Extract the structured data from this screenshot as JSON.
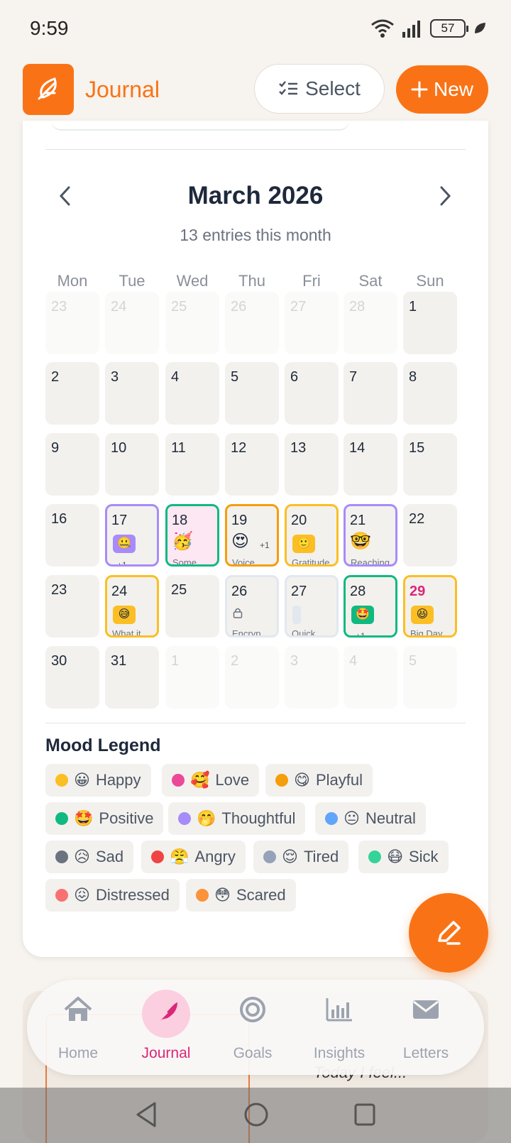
{
  "status_bar": {
    "time": "9:59",
    "battery": "57"
  },
  "header": {
    "title": "Journal",
    "select_label": "Select",
    "new_label": "New"
  },
  "calendar": {
    "month_title": "March 2026",
    "entries_summary": "13 entries this month",
    "weekdays": [
      "Mon",
      "Tue",
      "Wed",
      "Thu",
      "Fri",
      "Sat",
      "Sun"
    ],
    "weeks": [
      [
        {
          "num": "23",
          "muted": true
        },
        {
          "num": "24",
          "muted": true
        },
        {
          "num": "25",
          "muted": true
        },
        {
          "num": "26",
          "muted": true
        },
        {
          "num": "27",
          "muted": true
        },
        {
          "num": "28",
          "muted": true
        },
        {
          "num": "1"
        }
      ],
      [
        {
          "num": "2"
        },
        {
          "num": "3"
        },
        {
          "num": "4"
        },
        {
          "num": "5"
        },
        {
          "num": "6"
        },
        {
          "num": "7"
        },
        {
          "num": "8"
        }
      ],
      [
        {
          "num": "9"
        },
        {
          "num": "10"
        },
        {
          "num": "11"
        },
        {
          "num": "12"
        },
        {
          "num": "13"
        },
        {
          "num": "14"
        },
        {
          "num": "15"
        }
      ],
      [
        {
          "num": "16"
        },
        {
          "num": "17",
          "border": "#a78bfa",
          "chip": "#a78bfa",
          "emoji": "🤐",
          "plus": "+1"
        },
        {
          "num": "18",
          "border": "#10b981",
          "bg": "#fce7f3",
          "emoji": "🥳",
          "preview": "Some"
        },
        {
          "num": "19",
          "border": "#f59e0b",
          "emoji": "😍",
          "plus": "+1",
          "preview": "Voice"
        },
        {
          "num": "20",
          "border": "#fbbf24",
          "chip": "#fbbf24",
          "emoji": "🙂",
          "preview": "Gratitude"
        },
        {
          "num": "21",
          "border": "#a78bfa",
          "emoji": "🤓",
          "preview": "Reaching"
        },
        {
          "num": "22"
        }
      ],
      [
        {
          "num": "23"
        },
        {
          "num": "24",
          "border": "#fbbf24",
          "chip": "#fbbf24",
          "emoji": "😅",
          "preview": "What it"
        },
        {
          "num": "25"
        },
        {
          "num": "26",
          "border": "#e2e8f0",
          "lock": true,
          "preview": "Encryp"
        },
        {
          "num": "27",
          "border": "#e2e8f0",
          "placeholder": true,
          "preview": "Quick"
        },
        {
          "num": "28",
          "border": "#10b981",
          "chip": "#10b981",
          "emoji": "🤩",
          "plus": "+1"
        },
        {
          "num": "29",
          "border": "#fbbf24",
          "chip": "#fbbf24",
          "emoji": "😆",
          "preview": "Big Day",
          "today": true
        }
      ],
      [
        {
          "num": "30"
        },
        {
          "num": "31"
        },
        {
          "num": "1",
          "muted": true
        },
        {
          "num": "2",
          "muted": true
        },
        {
          "num": "3",
          "muted": true
        },
        {
          "num": "4",
          "muted": true
        },
        {
          "num": "5",
          "muted": true
        }
      ]
    ]
  },
  "legend": {
    "title": "Mood Legend",
    "items": [
      {
        "label": "Happy",
        "emoji": "😀",
        "color": "#fbbf24"
      },
      {
        "label": "Love",
        "emoji": "🥰",
        "color": "#ec4899"
      },
      {
        "label": "Playful",
        "emoji": "😋",
        "color": "#f59e0b"
      },
      {
        "label": "Positive",
        "emoji": "🤩",
        "color": "#10b981"
      },
      {
        "label": "Thoughtful",
        "emoji": "🤭",
        "color": "#a78bfa"
      },
      {
        "label": "Neutral",
        "emoji": "😐",
        "color": "#60a5fa"
      },
      {
        "label": "Sad",
        "emoji": "😥",
        "color": "#6b7280"
      },
      {
        "label": "Angry",
        "emoji": "😤",
        "color": "#ef4444"
      },
      {
        "label": "Tired",
        "emoji": "😌",
        "color": "#94a3b8"
      },
      {
        "label": "Sick",
        "emoji": "😷",
        "color": "#34d399"
      },
      {
        "label": "Distressed",
        "emoji": "😖",
        "color": "#f87171"
      },
      {
        "label": "Scared",
        "emoji": "😳",
        "color": "#fb923c"
      }
    ]
  },
  "bottom_nav": {
    "items": [
      {
        "label": "Home",
        "icon": "home-icon"
      },
      {
        "label": "Journal",
        "icon": "feather-icon",
        "active": true
      },
      {
        "label": "Goals",
        "icon": "target-icon"
      },
      {
        "label": "Insights",
        "icon": "bar-chart-icon"
      },
      {
        "label": "Letters",
        "icon": "mail-icon"
      }
    ]
  },
  "background": {
    "today_prompt": "Today I feel..."
  },
  "colors": {
    "accent": "#f97316",
    "active_nav": "#db2777"
  }
}
